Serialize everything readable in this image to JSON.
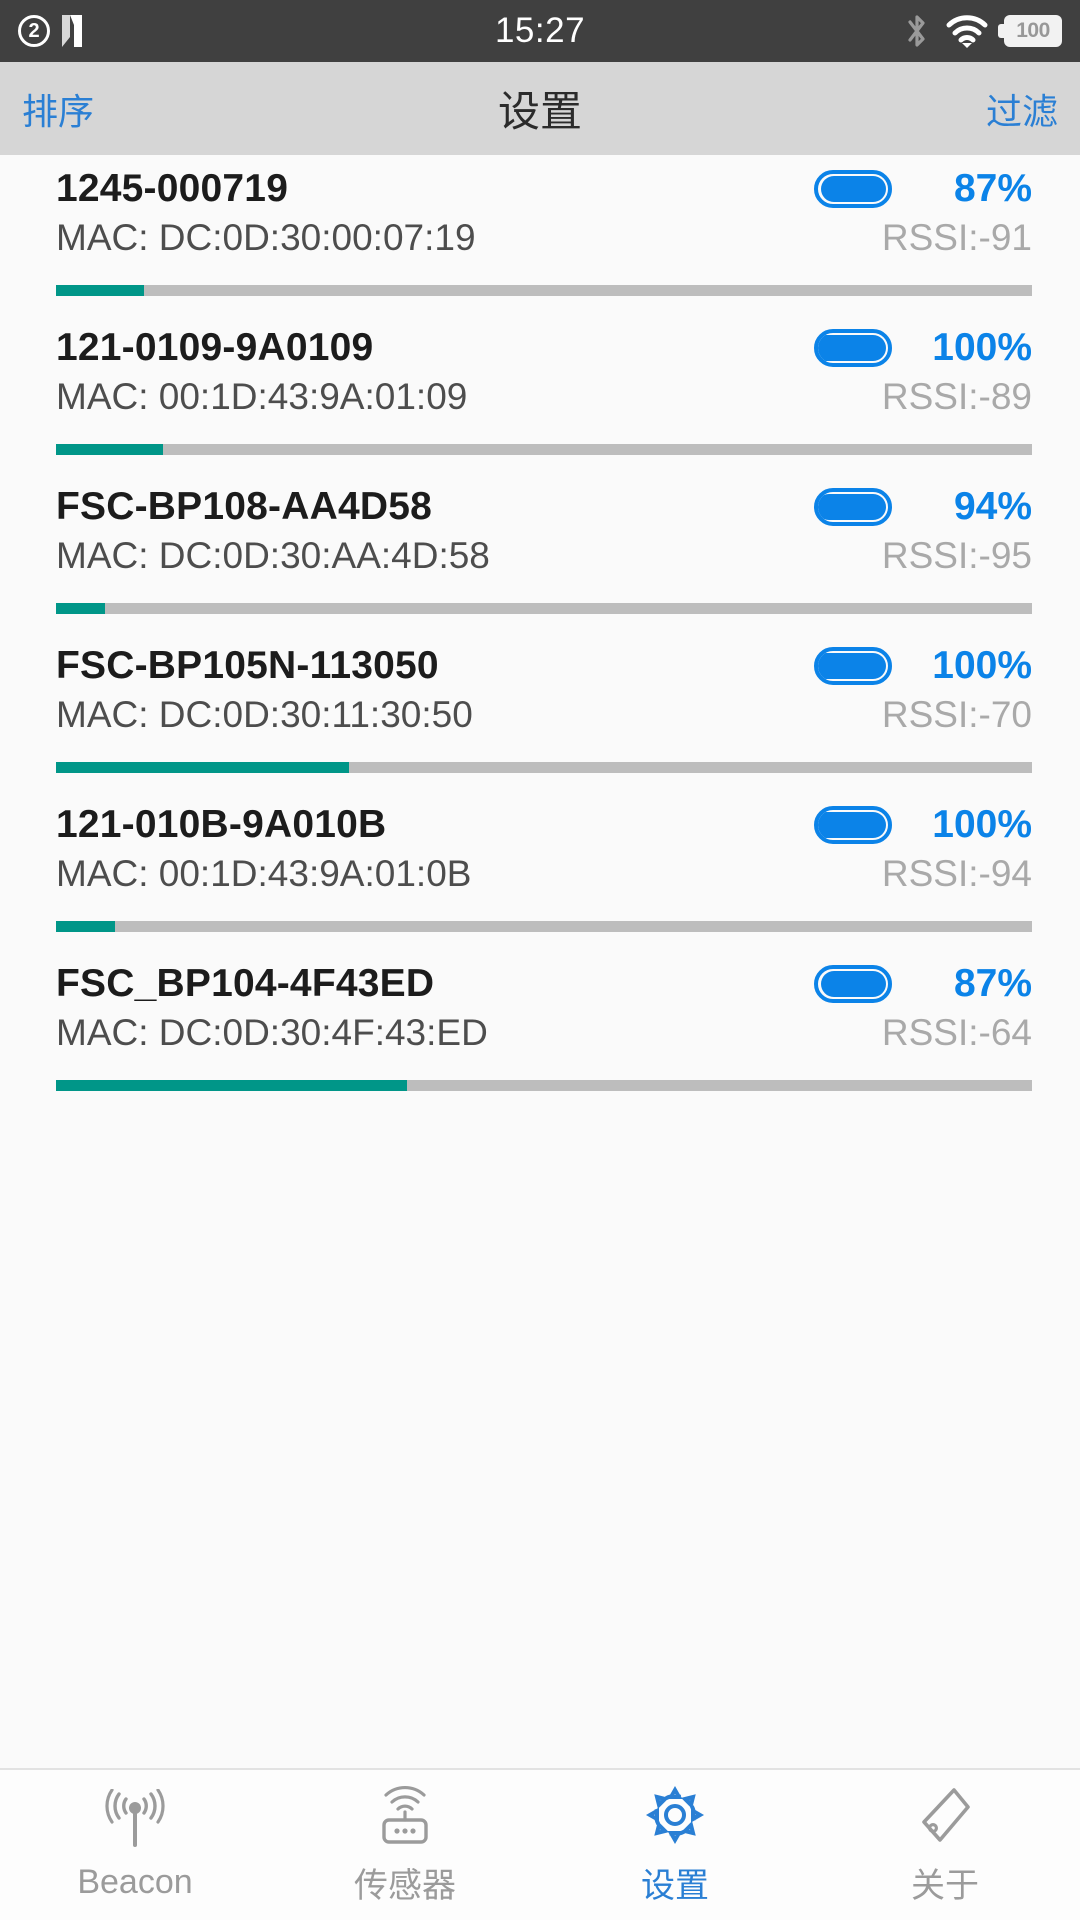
{
  "status_bar": {
    "notification_count": "2",
    "app_icon": "n-logo-icon",
    "time": "15:27",
    "bluetooth_icon": "bluetooth-icon",
    "wifi_icon": "wifi-icon",
    "battery_level": "100"
  },
  "nav_bar": {
    "left_label": "排序",
    "title": "设置",
    "right_label": "过滤"
  },
  "devices": [
    {
      "name": "1245-000719",
      "mac": "MAC: DC:0D:30:00:07:19",
      "battery_pct": "87%",
      "battery_fill": 87,
      "rssi": "RSSI:-91",
      "signal_pct": 9
    },
    {
      "name": "121-0109-9A0109",
      "mac": "MAC: 00:1D:43:9A:01:09",
      "battery_pct": "100%",
      "battery_fill": 100,
      "rssi": "RSSI:-89",
      "signal_pct": 11
    },
    {
      "name": "FSC-BP108-AA4D58",
      "mac": "MAC: DC:0D:30:AA:4D:58",
      "battery_pct": "94%",
      "battery_fill": 94,
      "rssi": "RSSI:-95",
      "signal_pct": 5
    },
    {
      "name": "FSC-BP105N-113050",
      "mac": "MAC: DC:0D:30:11:30:50",
      "battery_pct": "100%",
      "battery_fill": 100,
      "rssi": "RSSI:-70",
      "signal_pct": 30
    },
    {
      "name": "121-010B-9A010B",
      "mac": "MAC: 00:1D:43:9A:01:0B",
      "battery_pct": "100%",
      "battery_fill": 100,
      "rssi": "RSSI:-94",
      "signal_pct": 6
    },
    {
      "name": "FSC_BP104-4F43ED",
      "mac": "MAC: DC:0D:30:4F:43:ED",
      "battery_pct": "87%",
      "battery_fill": 87,
      "rssi": "RSSI:-64",
      "signal_pct": 36
    }
  ],
  "tab_bar": {
    "tabs": [
      {
        "label": "Beacon",
        "icon": "beacon-antenna-icon",
        "active": false
      },
      {
        "label": "传感器",
        "icon": "sensor-router-icon",
        "active": false
      },
      {
        "label": "设置",
        "icon": "gear-icon",
        "active": true
      },
      {
        "label": "关于",
        "icon": "tag-icon",
        "active": false
      }
    ]
  },
  "colors": {
    "accent_blue": "#0b83e8",
    "nav_blue": "#2a7fd4",
    "signal_teal": "#009688",
    "signal_track": "#bdbdbd",
    "statusbar_bg": "#404040",
    "navbar_bg": "#d6d6d6",
    "list_bg": "#fafafa"
  }
}
